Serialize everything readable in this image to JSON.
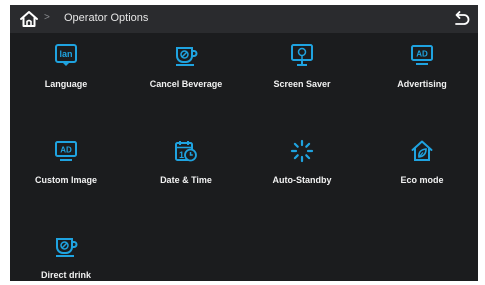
{
  "header": {
    "home_icon": "home-icon",
    "separator": ">",
    "title": "Operator Options",
    "back_icon": "back-arrow-icon"
  },
  "accent_color": "#1fa3e0",
  "options": [
    {
      "label": "Language",
      "icon": "lan-icon"
    },
    {
      "label": "Cancel Beverage",
      "icon": "cancel-cup-icon"
    },
    {
      "label": "Screen Saver",
      "icon": "monitor-icon"
    },
    {
      "label": "Advertising",
      "icon": "ad-screen-icon"
    },
    {
      "label": "Custom Image",
      "icon": "ad-screen-icon"
    },
    {
      "label": "Date & Time",
      "icon": "calendar-clock-icon"
    },
    {
      "label": "Auto-Standby",
      "icon": "loading-spinner-icon"
    },
    {
      "label": "Eco mode",
      "icon": "eco-house-leaf-icon"
    },
    {
      "label": "Direct drink",
      "icon": "cup-icon"
    }
  ],
  "icon_text": {
    "lan": "lan",
    "ad": "AD",
    "date": "1"
  }
}
